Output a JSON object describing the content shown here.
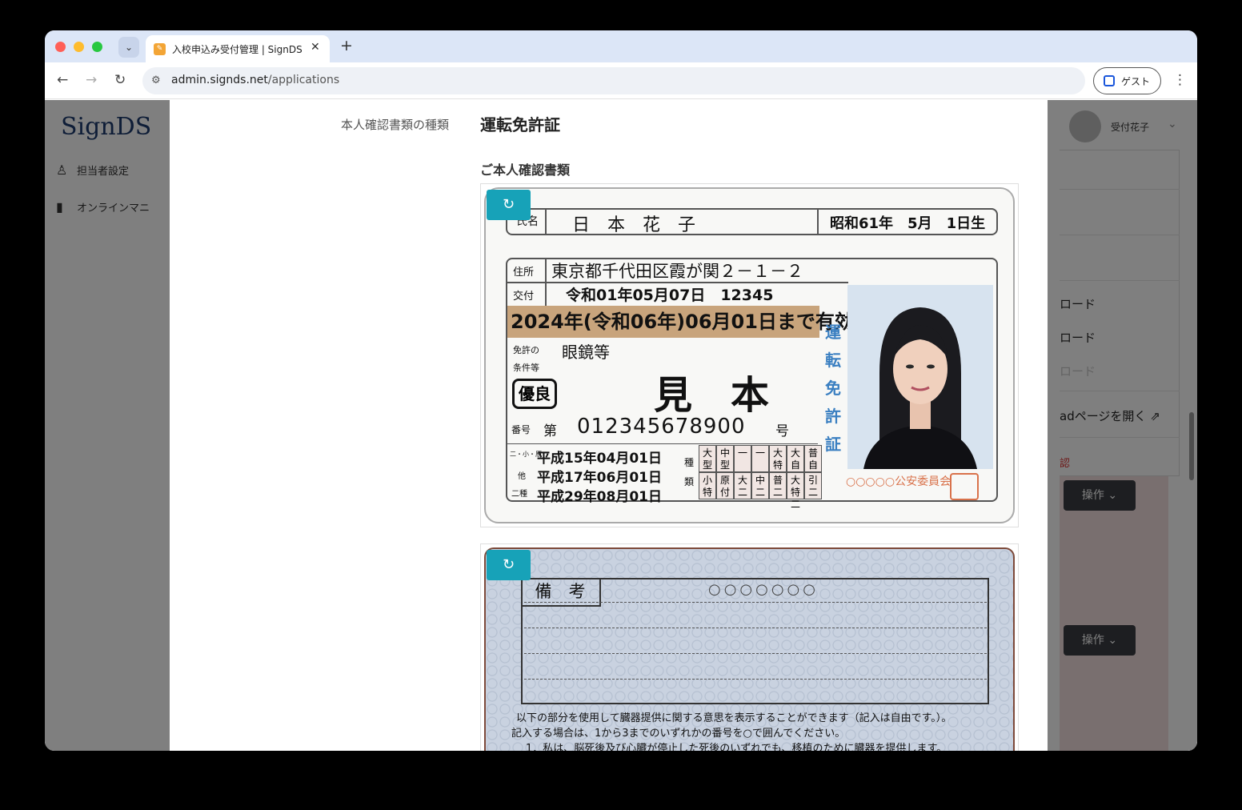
{
  "browser": {
    "tab_title": "入校申込み受付管理 | SignDS（",
    "url_host": "admin.signds.net",
    "url_path": "/applications",
    "guest_label": "ゲスト"
  },
  "background": {
    "logo": "SignDS",
    "nav": [
      {
        "label": "担当者設定",
        "icon": "user-icon"
      },
      {
        "label": "オンラインマニ",
        "icon": "book-icon"
      }
    ],
    "user_name": "受付花子",
    "dropdown_items": [
      {
        "label": "ロード",
        "muted": false
      },
      {
        "label": "ロード",
        "muted": false
      },
      {
        "label": "ロード",
        "muted": true
      },
      {
        "label": "adページを開く",
        "muted": false
      },
      {
        "label": "認",
        "muted": false
      }
    ],
    "operation_buttons": [
      "操作",
      "操作"
    ]
  },
  "modal": {
    "id_type_label": "本人確認書類の種類",
    "id_type_value": "運転免許証",
    "documents_title": "ご本人確認書類",
    "rotate_icon": "rotate-icon"
  },
  "license_front": {
    "name_label": "氏名",
    "name": "日　本　花　子",
    "birth": "昭和61年　5月　1日生",
    "addr_label": "住所",
    "address": "東京都千代田区霞が関２－１－２",
    "issue_label": "交付",
    "issue": "令和01年05月07日　12345",
    "expiry": "2024年(令和06年)06月01日まで有効",
    "cond_label_1": "免許の",
    "cond_label_2": "条件等",
    "condition": "眼鏡等",
    "sample": "見　本",
    "badge": "優良",
    "number_label": "番号",
    "number_prefix": "第",
    "number": "012345678900",
    "number_suffix": "号",
    "vertical_title": "運転免許証",
    "dates": [
      "平成15年04月01日",
      "平成17年06月01日",
      "平成29年08月01日"
    ],
    "date_labels": [
      "二・小・原",
      "他",
      "二種"
    ],
    "kind_label": "種類",
    "categories_top": [
      "大型",
      "中型",
      "一",
      "一",
      "大特",
      "大自二",
      "普自二"
    ],
    "categories_bottom": [
      "小特",
      "原付",
      "大二",
      "中二",
      "普二",
      "大特二",
      "引二"
    ],
    "authority": "○○○○○公安委員会"
  },
  "license_back": {
    "remarks_title": "備　考",
    "circles": "○○○○○○○",
    "line1": "以下の部分を使用して臓器提供に関する意思を表示することができます（記入は自由です。）。",
    "line2": "記入する場合は、1から3までのいずれかの番号を○で囲んでください。",
    "line3": "1．私は、脳死後及び心臓が停止した死後のいずれでも、移植のために臓器を提供します。"
  }
}
